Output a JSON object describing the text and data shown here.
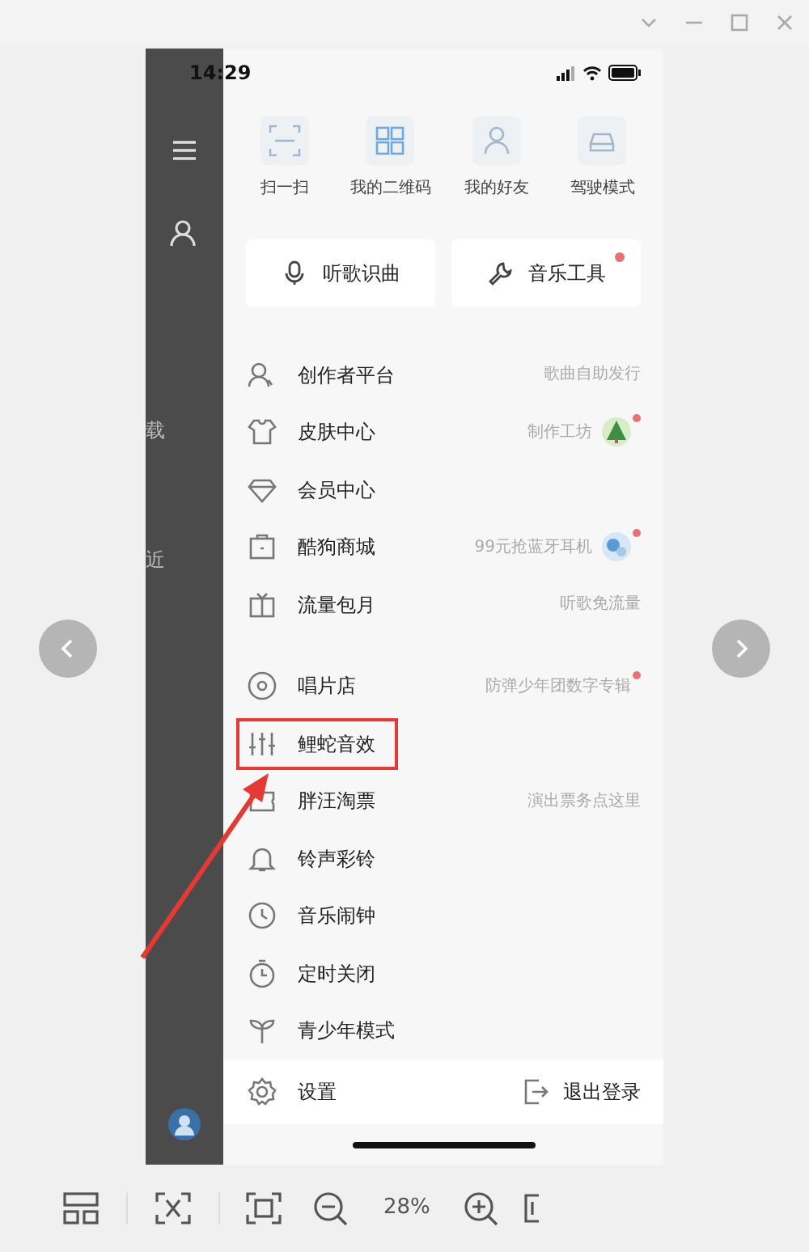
{
  "status_bar": {
    "time": "14:29"
  },
  "side_fragments": [
    "载",
    "近"
  ],
  "quick_actions": [
    {
      "label": "扫一扫"
    },
    {
      "label": "我的二维码"
    },
    {
      "label": "我的好友"
    },
    {
      "label": "驾驶模式"
    }
  ],
  "cards": [
    {
      "label": "听歌识曲",
      "badge": false
    },
    {
      "label": "音乐工具",
      "badge": true
    }
  ],
  "menu_sections": [
    [
      {
        "label": "创作者平台",
        "hint": "歌曲自助发行",
        "thumbnail": false,
        "badge": false,
        "annotated": false
      },
      {
        "label": "皮肤中心",
        "hint": "制作工坊",
        "thumbnail": true,
        "badge": true,
        "annotated": false
      },
      {
        "label": "会员中心",
        "thumbnail": false,
        "badge": false,
        "annotated": false
      },
      {
        "label": "酷狗商城",
        "hint": "99元抢蓝牙耳机",
        "thumbnail": true,
        "badge": true,
        "annotated": false
      },
      {
        "label": "流量包月",
        "hint": "听歌免流量",
        "thumbnail": false,
        "badge": false,
        "annotated": false
      }
    ],
    [
      {
        "label": "唱片店",
        "hint": "防弹少年团数字专辑",
        "thumbnail": false,
        "badge": true,
        "annotated": false
      },
      {
        "label": "鲤蛇音效",
        "thumbnail": false,
        "badge": false,
        "annotated": true
      },
      {
        "label": "胖汪淘票",
        "hint": "演出票务点这里",
        "thumbnail": false,
        "badge": false,
        "annotated": false
      },
      {
        "label": "铃声彩铃",
        "thumbnail": false,
        "badge": false,
        "annotated": false
      },
      {
        "label": "音乐闹钟",
        "thumbnail": false,
        "badge": false,
        "annotated": false
      },
      {
        "label": "定时关闭",
        "thumbnail": false,
        "badge": false,
        "annotated": false
      },
      {
        "label": "青少年模式",
        "thumbnail": false,
        "badge": false,
        "annotated": false
      }
    ]
  ],
  "footer": {
    "settings": "设置",
    "logout": "退出登录"
  },
  "toolbar": {
    "zoom": "28%"
  }
}
